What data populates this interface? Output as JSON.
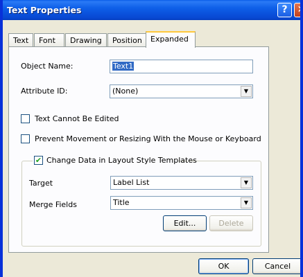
{
  "window": {
    "title": "Text Properties"
  },
  "titlebar": {
    "help_glyph": "?",
    "close_glyph": "✕"
  },
  "tabs": [
    {
      "label": "Text"
    },
    {
      "label": "Font"
    },
    {
      "label": "Drawing"
    },
    {
      "label": "Position"
    },
    {
      "label": "Expanded",
      "active": true
    }
  ],
  "fields": {
    "object_name_label": "Object Name:",
    "object_name_value": "Text1",
    "attribute_id_label": "Attribute ID:",
    "attribute_id_value": "(None)"
  },
  "checkboxes": {
    "text_cannot_be_edited": {
      "label": "Text Cannot Be Edited",
      "checked": false
    },
    "prevent_movement": {
      "label": "Prevent Movement or Resizing With the Mouse or Keyboard",
      "checked": false
    },
    "change_data": {
      "label": "Change Data in Layout Style Templates",
      "checked": true,
      "mark": "✔"
    }
  },
  "group": {
    "target_label": "Target",
    "target_value": "Label List",
    "merge_fields_label": "Merge Fields",
    "merge_fields_value": "Title",
    "edit_button": "Edit...",
    "delete_button": "Delete"
  },
  "footer": {
    "ok_button": "OK",
    "cancel_button": "Cancel"
  },
  "colors": {
    "titlebar": "#0a5ee8",
    "dialog_bg": "#ece9d8",
    "active_tab_highlight": "#ffc83c",
    "selection": "#316ac5"
  }
}
